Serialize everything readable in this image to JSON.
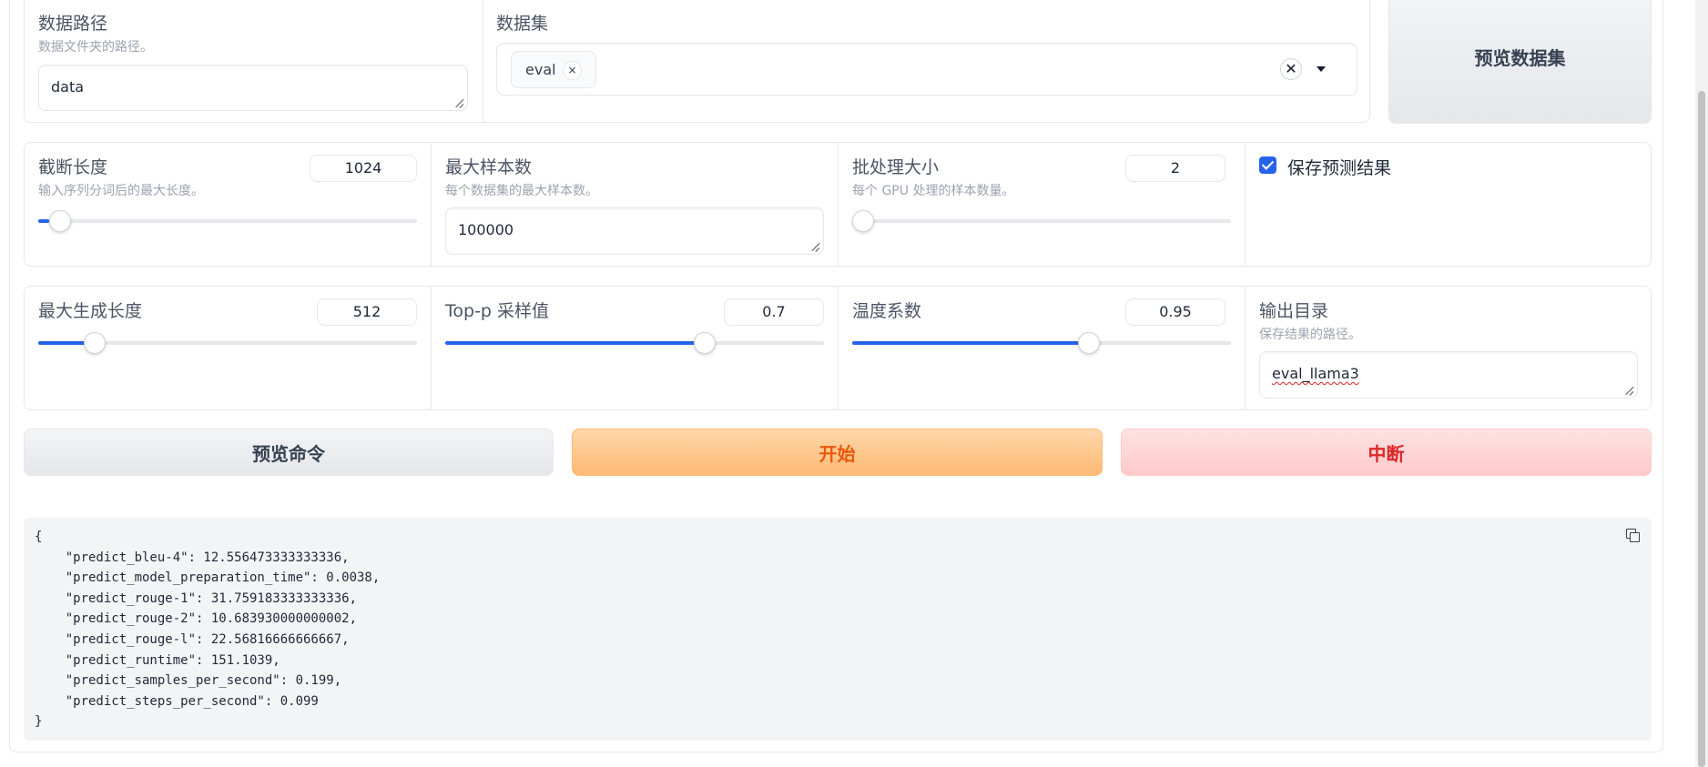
{
  "dataset_row": {
    "data_path": {
      "label": "数据路径",
      "info": "数据文件夹的路径。",
      "value": "data"
    },
    "dataset": {
      "label": "数据集",
      "chips": [
        "eval"
      ],
      "clear_icon": "✕",
      "chip_remove_icon": "×"
    },
    "preview_dataset_button": "预览数据集"
  },
  "params_row1": {
    "cutoff_len": {
      "label": "截断长度",
      "info": "输入序列分词后的最大长度。",
      "value": "1024",
      "fill_fraction": 0.03
    },
    "max_samples": {
      "label": "最大样本数",
      "info": "每个数据集的最大样本数。",
      "value": "100000"
    },
    "batch_size": {
      "label": "批处理大小",
      "info": "每个 GPU 处理的样本数量。",
      "value": "2",
      "fill_fraction": 0.0
    },
    "predict": {
      "label": "保存预测结果",
      "checked": true
    }
  },
  "params_row2": {
    "max_new_tokens": {
      "label": "最大生成长度",
      "value": "512",
      "fill_fraction": 0.148
    },
    "top_p": {
      "label": "Top-p 采样值",
      "value": "0.7",
      "fill_fraction": 0.686
    },
    "temperature": {
      "label": "温度系数",
      "value": "0.95",
      "fill_fraction": 0.624
    },
    "output_dir": {
      "label": "输出目录",
      "info": "保存结果的路径。",
      "value": "eval_llama3"
    }
  },
  "actions": {
    "preview_command": "预览命令",
    "start": "开始",
    "abort": "中断"
  },
  "output": {
    "open_brace": "{",
    "lines": [
      "    \"predict_bleu-4\": 12.556473333333336,",
      "    \"predict_model_preparation_time\": 0.0038,",
      "    \"predict_rouge-1\": 31.759183333333336,",
      "    \"predict_rouge-2\": 10.683930000000002,",
      "    \"predict_rouge-l\": 22.56816666666667,",
      "    \"predict_runtime\": 151.1039,",
      "    \"predict_samples_per_second\": 0.199,",
      "    \"predict_steps_per_second\": 0.099"
    ],
    "close_brace": "}"
  },
  "colors": {
    "accent": "#2563eb",
    "start_text": "#ea580c",
    "abort_text": "#dc2626"
  }
}
